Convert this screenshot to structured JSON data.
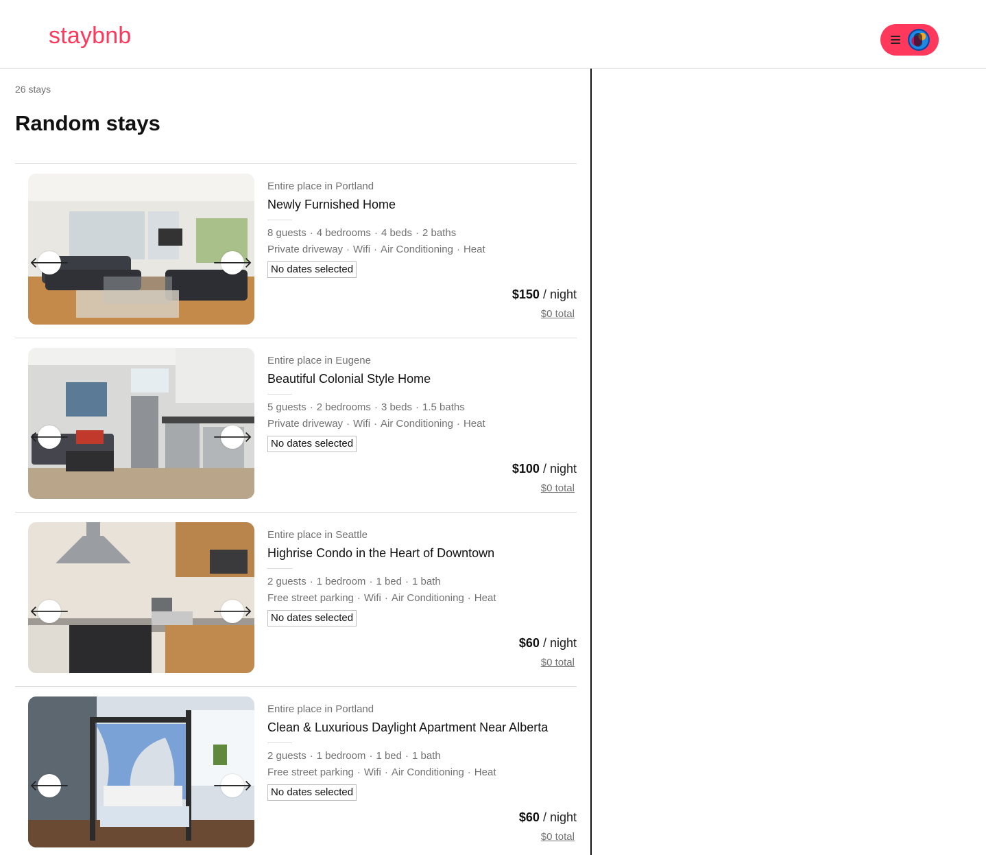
{
  "header": {
    "logo": "staybnb",
    "menu_icon": "hamburger-icon",
    "avatar": "user-avatar"
  },
  "results": {
    "count_label": "26 stays",
    "heading": "Random stays",
    "listings": [
      {
        "type_location": "Entire place in Portland",
        "name": "Newly Furnished Home",
        "specs": [
          "8 guests",
          "4 bedrooms",
          "4 beds",
          "2 baths"
        ],
        "amenities": [
          "Private driveway",
          "Wifi",
          "Air Conditioning",
          "Heat"
        ],
        "dates": "No dates selected",
        "price": "$150",
        "price_unit": "/ night",
        "total": "$0 total",
        "photo": "living-room-photo"
      },
      {
        "type_location": "Entire place in Eugene",
        "name": "Beautiful Colonial Style Home",
        "specs": [
          "5 guests",
          "2 bedrooms",
          "3 beds",
          "1.5 baths"
        ],
        "amenities": [
          "Private driveway",
          "Wifi",
          "Air Conditioning",
          "Heat"
        ],
        "dates": "No dates selected",
        "price": "$100",
        "price_unit": "/ night",
        "total": "$0 total",
        "photo": "kitchen-living-photo"
      },
      {
        "type_location": "Entire place in Seattle",
        "name": "Highrise Condo in the Heart of Downtown",
        "specs": [
          "2 guests",
          "1 bedroom",
          "1 bed",
          "1 bath"
        ],
        "amenities": [
          "Free street parking",
          "Wifi",
          "Air Conditioning",
          "Heat"
        ],
        "dates": "No dates selected",
        "price": "$60",
        "price_unit": "/ night",
        "total": "$0 total",
        "photo": "kitchen-photo"
      },
      {
        "type_location": "Entire place in Portland",
        "name": "Clean & Luxurious Daylight Apartment Near Alberta",
        "specs": [
          "2 guests",
          "1 bedroom",
          "1 bed",
          "1 bath"
        ],
        "amenities": [
          "Free street parking",
          "Wifi",
          "Air Conditioning",
          "Heat"
        ],
        "dates": "No dates selected",
        "price": "$60",
        "price_unit": "/ night",
        "total": "$0 total",
        "photo": "bedroom-photo"
      }
    ]
  },
  "icons": {
    "prev": "arrow-left-icon",
    "next": "arrow-right-icon",
    "prev_glyph": "🡐",
    "next_glyph": "🡒"
  },
  "colors": {
    "brand": "#ff385c",
    "muted_text": "#717171",
    "border": "#dddddd"
  }
}
